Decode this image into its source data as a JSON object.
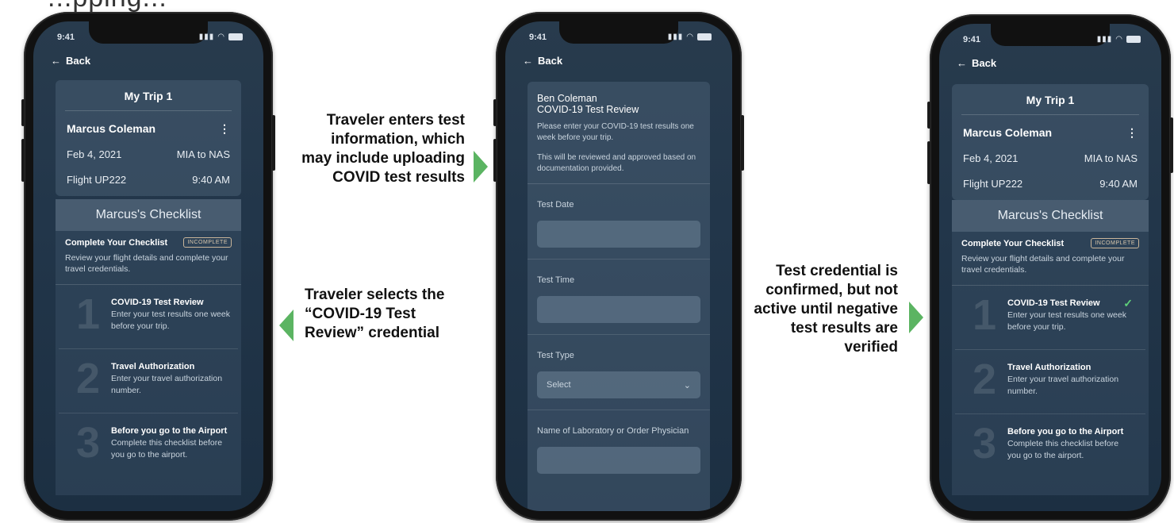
{
  "top_fragment": "...pping...",
  "status": {
    "time": "9:41"
  },
  "back_label": "Back",
  "left_phone": {
    "trip_title": "My Trip 1",
    "traveler": "Marcus Coleman",
    "date": "Feb 4, 2021",
    "route": "MIA to NAS",
    "flight": "Flight UP222",
    "time": "9:40 AM",
    "checklist_title": "Marcus's Checklist",
    "complete_heading": "Complete Your Checklist",
    "badge": "INCOMPLETE",
    "desc": "Review your flight details and complete your travel credentials.",
    "steps": [
      {
        "num": "1",
        "title": "COVID-19 Test Review",
        "desc": "Enter your test results one week before your trip."
      },
      {
        "num": "2",
        "title": "Travel Authorization",
        "desc": "Enter your travel authorization number."
      },
      {
        "num": "3",
        "title": "Before you go to the Airport",
        "desc": "Complete this checklist before you go to the airport."
      }
    ]
  },
  "middle_phone": {
    "name": "Ben Coleman",
    "heading": "COVID-19 Test Review",
    "p1": "Please enter your COVID-19 test results one week before your trip.",
    "p2": "This will be reviewed and approved based on documentation provided.",
    "fields": {
      "test_date": "Test Date",
      "test_time": "Test Time",
      "test_type": "Test Type",
      "select_placeholder": "Select",
      "lab": "Name of Laboratory or Order Physician"
    }
  },
  "captions": {
    "c1": "Traveler selects the  “COVID-19 Test Review” credential",
    "c2": "Traveler enters test information, which may include uploading COVID test results",
    "c3": "Test credential is confirmed, but not active until negative test results are verified"
  },
  "colors": {
    "arrow": "#5bb462",
    "check": "#5fd17a"
  }
}
